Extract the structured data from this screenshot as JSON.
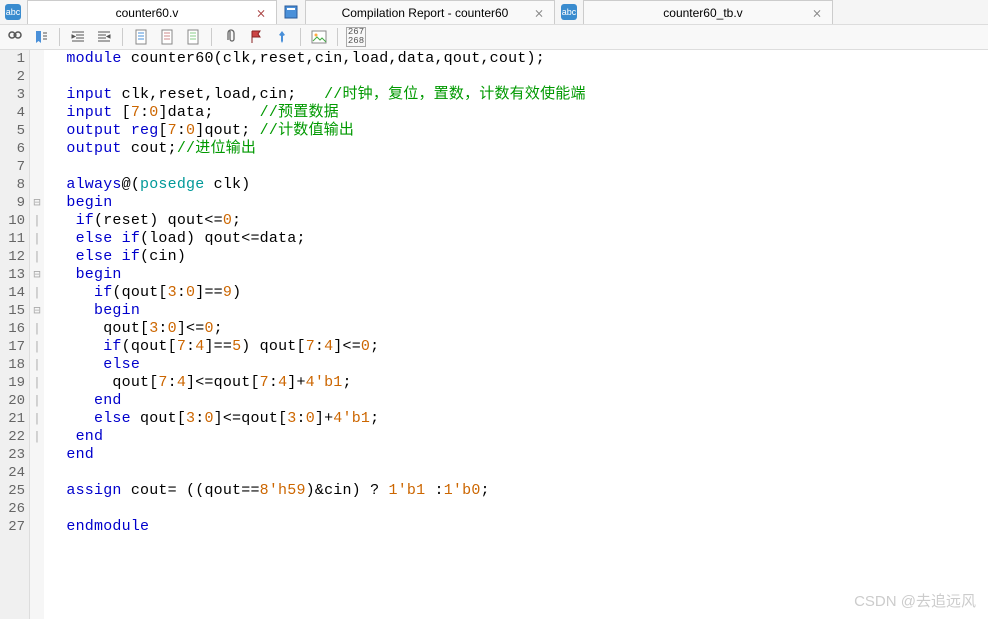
{
  "tabs": [
    {
      "label": "counter60.v",
      "active": true
    },
    {
      "label": "Compilation Report - counter60",
      "active": false
    },
    {
      "label": "counter60_tb.v",
      "active": false
    }
  ],
  "toolbar_ratio": "267\n268",
  "watermark": "CSDN @去追远风",
  "code": {
    "lines": [
      {
        "n": "1",
        "fold": "",
        "tokens": [
          {
            "t": "  ",
            "c": "plain"
          },
          {
            "t": "module",
            "c": "k-blue"
          },
          {
            "t": " counter60(clk,reset,cin,load,data,qout,cout);",
            "c": "plain"
          }
        ]
      },
      {
        "n": "2",
        "fold": "",
        "tokens": []
      },
      {
        "n": "3",
        "fold": "",
        "tokens": [
          {
            "t": "  ",
            "c": "plain"
          },
          {
            "t": "input",
            "c": "k-blue"
          },
          {
            "t": " clk,reset,load,cin;   ",
            "c": "plain"
          },
          {
            "t": "//时钟，复位，置数，计数有效使能端",
            "c": "k-green"
          }
        ]
      },
      {
        "n": "4",
        "fold": "",
        "tokens": [
          {
            "t": "  ",
            "c": "plain"
          },
          {
            "t": "input",
            "c": "k-blue"
          },
          {
            "t": " [",
            "c": "plain"
          },
          {
            "t": "7",
            "c": "k-orange"
          },
          {
            "t": ":",
            "c": "plain"
          },
          {
            "t": "0",
            "c": "k-orange"
          },
          {
            "t": "]data;     ",
            "c": "plain"
          },
          {
            "t": "//预置数据",
            "c": "k-green"
          }
        ]
      },
      {
        "n": "5",
        "fold": "",
        "tokens": [
          {
            "t": "  ",
            "c": "plain"
          },
          {
            "t": "output",
            "c": "k-blue"
          },
          {
            "t": " ",
            "c": "plain"
          },
          {
            "t": "reg",
            "c": "k-blue"
          },
          {
            "t": "[",
            "c": "plain"
          },
          {
            "t": "7",
            "c": "k-orange"
          },
          {
            "t": ":",
            "c": "plain"
          },
          {
            "t": "0",
            "c": "k-orange"
          },
          {
            "t": "]qout; ",
            "c": "plain"
          },
          {
            "t": "//计数值输出",
            "c": "k-green"
          }
        ]
      },
      {
        "n": "6",
        "fold": "",
        "tokens": [
          {
            "t": "  ",
            "c": "plain"
          },
          {
            "t": "output",
            "c": "k-blue"
          },
          {
            "t": " cout;",
            "c": "plain"
          },
          {
            "t": "//进位输出",
            "c": "k-green"
          }
        ]
      },
      {
        "n": "7",
        "fold": "",
        "tokens": []
      },
      {
        "n": "8",
        "fold": "",
        "tokens": [
          {
            "t": "  ",
            "c": "plain"
          },
          {
            "t": "always",
            "c": "k-blue"
          },
          {
            "t": "@(",
            "c": "plain"
          },
          {
            "t": "posedge",
            "c": "k-teal"
          },
          {
            "t": " clk)",
            "c": "plain"
          }
        ]
      },
      {
        "n": "9",
        "fold": "⊟",
        "tokens": [
          {
            "t": "  ",
            "c": "plain"
          },
          {
            "t": "begin",
            "c": "k-blue"
          }
        ]
      },
      {
        "n": "10",
        "fold": "|",
        "tokens": [
          {
            "t": "   ",
            "c": "plain"
          },
          {
            "t": "if",
            "c": "k-blue"
          },
          {
            "t": "(reset) qout<=",
            "c": "plain"
          },
          {
            "t": "0",
            "c": "k-orange"
          },
          {
            "t": ";",
            "c": "plain"
          }
        ]
      },
      {
        "n": "11",
        "fold": "|",
        "tokens": [
          {
            "t": "   ",
            "c": "plain"
          },
          {
            "t": "else",
            "c": "k-blue"
          },
          {
            "t": " ",
            "c": "plain"
          },
          {
            "t": "if",
            "c": "k-blue"
          },
          {
            "t": "(load) qout<=data;",
            "c": "plain"
          }
        ]
      },
      {
        "n": "12",
        "fold": "|",
        "tokens": [
          {
            "t": "   ",
            "c": "plain"
          },
          {
            "t": "else",
            "c": "k-blue"
          },
          {
            "t": " ",
            "c": "plain"
          },
          {
            "t": "if",
            "c": "k-blue"
          },
          {
            "t": "(cin)",
            "c": "plain"
          }
        ]
      },
      {
        "n": "13",
        "fold": "⊟",
        "tokens": [
          {
            "t": "   ",
            "c": "plain"
          },
          {
            "t": "begin",
            "c": "k-blue"
          }
        ]
      },
      {
        "n": "14",
        "fold": "|",
        "tokens": [
          {
            "t": "     ",
            "c": "plain"
          },
          {
            "t": "if",
            "c": "k-blue"
          },
          {
            "t": "(qout[",
            "c": "plain"
          },
          {
            "t": "3",
            "c": "k-orange"
          },
          {
            "t": ":",
            "c": "plain"
          },
          {
            "t": "0",
            "c": "k-orange"
          },
          {
            "t": "]==",
            "c": "plain"
          },
          {
            "t": "9",
            "c": "k-orange"
          },
          {
            "t": ")",
            "c": "plain"
          }
        ]
      },
      {
        "n": "15",
        "fold": "⊟",
        "tokens": [
          {
            "t": "     ",
            "c": "plain"
          },
          {
            "t": "begin",
            "c": "k-blue"
          }
        ]
      },
      {
        "n": "16",
        "fold": "|",
        "tokens": [
          {
            "t": "      qout[",
            "c": "plain"
          },
          {
            "t": "3",
            "c": "k-orange"
          },
          {
            "t": ":",
            "c": "plain"
          },
          {
            "t": "0",
            "c": "k-orange"
          },
          {
            "t": "]<=",
            "c": "plain"
          },
          {
            "t": "0",
            "c": "k-orange"
          },
          {
            "t": ";",
            "c": "plain"
          }
        ]
      },
      {
        "n": "17",
        "fold": "|",
        "tokens": [
          {
            "t": "      ",
            "c": "plain"
          },
          {
            "t": "if",
            "c": "k-blue"
          },
          {
            "t": "(qout[",
            "c": "plain"
          },
          {
            "t": "7",
            "c": "k-orange"
          },
          {
            "t": ":",
            "c": "plain"
          },
          {
            "t": "4",
            "c": "k-orange"
          },
          {
            "t": "]==",
            "c": "plain"
          },
          {
            "t": "5",
            "c": "k-orange"
          },
          {
            "t": ") qout[",
            "c": "plain"
          },
          {
            "t": "7",
            "c": "k-orange"
          },
          {
            "t": ":",
            "c": "plain"
          },
          {
            "t": "4",
            "c": "k-orange"
          },
          {
            "t": "]<=",
            "c": "plain"
          },
          {
            "t": "0",
            "c": "k-orange"
          },
          {
            "t": ";",
            "c": "plain"
          }
        ]
      },
      {
        "n": "18",
        "fold": "|",
        "tokens": [
          {
            "t": "      ",
            "c": "plain"
          },
          {
            "t": "else",
            "c": "k-blue"
          }
        ]
      },
      {
        "n": "19",
        "fold": "|",
        "tokens": [
          {
            "t": "       qout[",
            "c": "plain"
          },
          {
            "t": "7",
            "c": "k-orange"
          },
          {
            "t": ":",
            "c": "plain"
          },
          {
            "t": "4",
            "c": "k-orange"
          },
          {
            "t": "]<=qout[",
            "c": "plain"
          },
          {
            "t": "7",
            "c": "k-orange"
          },
          {
            "t": ":",
            "c": "plain"
          },
          {
            "t": "4",
            "c": "k-orange"
          },
          {
            "t": "]+",
            "c": "plain"
          },
          {
            "t": "4'b1",
            "c": "k-orange"
          },
          {
            "t": ";",
            "c": "plain"
          }
        ]
      },
      {
        "n": "20",
        "fold": "|",
        "tokens": [
          {
            "t": "     ",
            "c": "plain"
          },
          {
            "t": "end",
            "c": "k-blue"
          }
        ]
      },
      {
        "n": "21",
        "fold": "|",
        "tokens": [
          {
            "t": "     ",
            "c": "plain"
          },
          {
            "t": "else",
            "c": "k-blue"
          },
          {
            "t": " qout[",
            "c": "plain"
          },
          {
            "t": "3",
            "c": "k-orange"
          },
          {
            "t": ":",
            "c": "plain"
          },
          {
            "t": "0",
            "c": "k-orange"
          },
          {
            "t": "]<=qout[",
            "c": "plain"
          },
          {
            "t": "3",
            "c": "k-orange"
          },
          {
            "t": ":",
            "c": "plain"
          },
          {
            "t": "0",
            "c": "k-orange"
          },
          {
            "t": "]+",
            "c": "plain"
          },
          {
            "t": "4'b1",
            "c": "k-orange"
          },
          {
            "t": ";",
            "c": "plain"
          }
        ]
      },
      {
        "n": "22",
        "fold": "|",
        "tokens": [
          {
            "t": "   ",
            "c": "plain"
          },
          {
            "t": "end",
            "c": "k-blue"
          }
        ]
      },
      {
        "n": "23",
        "fold": "",
        "tokens": [
          {
            "t": "  ",
            "c": "plain"
          },
          {
            "t": "end",
            "c": "k-blue"
          }
        ]
      },
      {
        "n": "24",
        "fold": "",
        "tokens": []
      },
      {
        "n": "25",
        "fold": "",
        "tokens": [
          {
            "t": "  ",
            "c": "plain"
          },
          {
            "t": "assign",
            "c": "k-blue"
          },
          {
            "t": " cout= ((qout==",
            "c": "plain"
          },
          {
            "t": "8'h59",
            "c": "k-orange"
          },
          {
            "t": ")&cin) ? ",
            "c": "plain"
          },
          {
            "t": "1'b1",
            "c": "k-orange"
          },
          {
            "t": " :",
            "c": "plain"
          },
          {
            "t": "1'b0",
            "c": "k-orange"
          },
          {
            "t": ";",
            "c": "plain"
          }
        ]
      },
      {
        "n": "26",
        "fold": "",
        "tokens": []
      },
      {
        "n": "27",
        "fold": "",
        "tokens": [
          {
            "t": "  ",
            "c": "plain"
          },
          {
            "t": "endmodule",
            "c": "k-blue"
          }
        ]
      }
    ]
  }
}
